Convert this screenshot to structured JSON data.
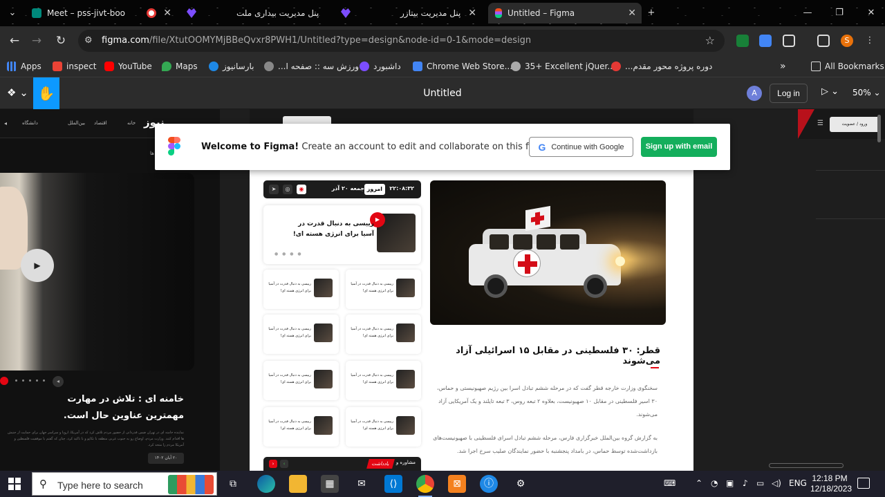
{
  "browser": {
    "tabs": [
      {
        "title": "Meet – pss-jivt-boo",
        "icon_color": "#00897b",
        "active": false
      },
      {
        "title": "",
        "icon_color": "#e53935",
        "recording": true,
        "active": false
      },
      {
        "title": "پنل مدیریت بیداری ملت",
        "icon_color": "#7c4dff",
        "active": false
      },
      {
        "title": "پنل مدیریت بیتازر",
        "icon_color": "#7c4dff",
        "active": false
      },
      {
        "title": "Untitled – Figma",
        "icon_color": "#f24e1e",
        "active": true
      }
    ],
    "new_tab_label": "+",
    "url_host": "figma.com",
    "url_path": "/file/XtutOOMYMjBBeQvxr8PWH1/Untitled?type=design&node-id=0-1&mode=design",
    "profile_initial": "S",
    "bookmarks": [
      {
        "label": "Apps",
        "icon": "grid-icon",
        "color": "#4285f4"
      },
      {
        "label": "inspect",
        "icon": "gmail-icon",
        "color": "#ea4335"
      },
      {
        "label": "YouTube",
        "icon": "youtube-icon",
        "color": "#ff0000"
      },
      {
        "label": "Maps",
        "icon": "maps-icon",
        "color": "#34a853"
      },
      {
        "label": "بارسانیوز",
        "icon": "site-icon",
        "color": "#1e88e5"
      },
      {
        "label": "ورزش سه :: صفحه ا...",
        "icon": "site-icon",
        "color": "#888888"
      },
      {
        "label": "داشبورد",
        "icon": "site-icon",
        "color": "#7c4dff"
      },
      {
        "label": "Chrome Web Store...",
        "icon": "store-icon",
        "color": "#4285f4"
      },
      {
        "label": "35+ Excellent jQuer...",
        "icon": "site-icon",
        "color": "#aaaaaa"
      },
      {
        "label": "دوره پروژه محور مقدم...",
        "icon": "site-icon",
        "color": "#e53935"
      }
    ],
    "all_bookmarks": "All Bookmarks"
  },
  "figma": {
    "file_title": "Untitled",
    "avatar_initial": "A",
    "login_label": "Log in",
    "zoom": "50%",
    "welcome_bold": "Welcome to Figma!",
    "welcome_rest": " Create an account to edit and collaborate on this file.",
    "google_label": "Continue with Google",
    "signup_label": "Sign up with email"
  },
  "design": {
    "left": {
      "logo": "نیوز",
      "nav": [
        "خانه",
        "اقتصاد",
        "بین‌الملل",
        "دانشگاه"
      ],
      "headline": "خامنه ای : تلاش در مهارت مهمترین عناوین حال است.",
      "body": "نماینده خامنه ای در تهران ضمن قدردانی از حضور مردم تلاش کرد که در آمریکا، اروپا و سراسر جهان برای حمایت از جنبش ها اقدام کنند. وزارت مردم، اوضاع رو به جنوب غربی منطقه با تکاپو و با تاکید کرد، چنان که گفتم با موفقیت فلسطین و آمریکا مردم را متحد کرد.",
      "date": "۲۰ آبان ۱۴۰۲",
      "partial_text": "ها"
    },
    "center": {
      "clock": "۲۲:۰۸:۳۲",
      "today_label": "امروز",
      "date_text": "جمعه ۲۰ آذر",
      "feature_title": "رییسی به دنبال قدرت در آسیا برای انرژی هسته ای!",
      "mini_title": "رییسی به دنبال قدرت در آسیا برای انرژی هسته ای!",
      "bottom_tag": "یادداشت",
      "bottom_tag2": "مشاوره و",
      "article_title": "قطر: ۳۰ فلسطینی در مقابل ۱۵ اسرائیلی آزاد می‌شوند",
      "article_p1": "سخنگوی وزارت خارجه قطر گفت که در مرحله ششم تبادل اسرا بین رژیم صهیونیستی و حماس، ۳۰ اسیر فلسطینی در مقابل ۱۰ صهیونیست، بعلاوه ۲ تبعه روس، ۳ تبعه تایلند و یک آمریکایی آزاد می‌شوند.",
      "article_p2": "به گزارش گروه بین‌الملل خبرگزاری فارس، مرحله ششم تبادل اسرای فلسطینی با صهیونیست‌های بازداشت‌شده توسط حماس، در بامداد پنجشنبه با حضور نمایندگان صلیب سرخ اجرا شد."
    },
    "right": {
      "login_label": "ورود / عضویت"
    }
  },
  "taskbar": {
    "search_placeholder": "Type here to search",
    "language": "ENG",
    "time": "12:18 PM",
    "date": "12/18/2023"
  }
}
